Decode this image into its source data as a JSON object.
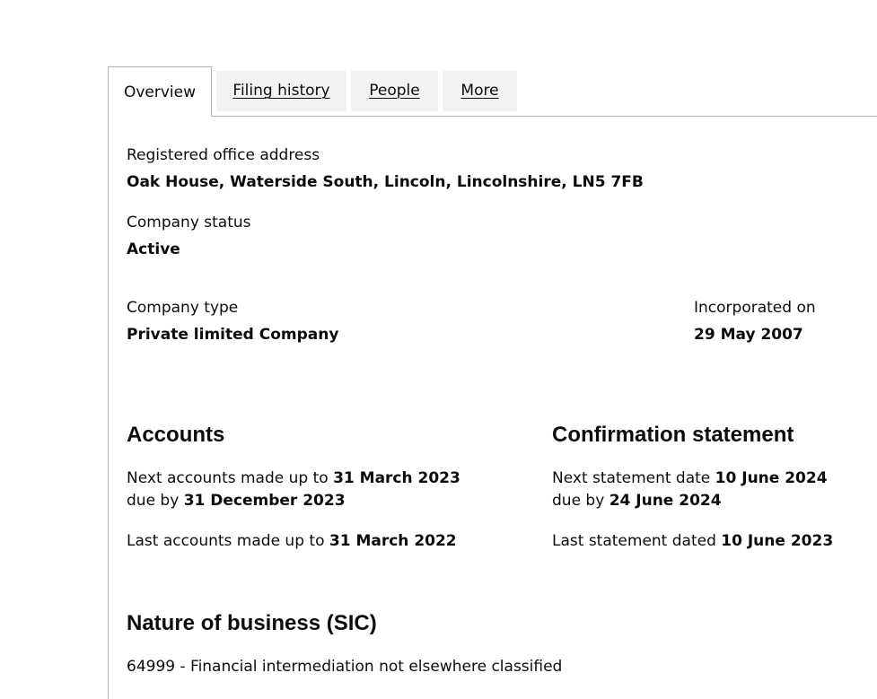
{
  "tabs": {
    "overview": "Overview",
    "filing_history": "Filing history",
    "people": "People",
    "more": "More"
  },
  "registered_office": {
    "label": "Registered office address",
    "value": "Oak House, Waterside South, Lincoln, Lincolnshire, LN5 7FB"
  },
  "company_status": {
    "label": "Company status",
    "value": "Active"
  },
  "company_type": {
    "label": "Company type",
    "value": "Private limited Company"
  },
  "incorporated": {
    "label": "Incorporated on",
    "value": "29 May 2007"
  },
  "accounts": {
    "heading": "Accounts",
    "next_prefix": "Next accounts made up to ",
    "next_date": "31 March 2023",
    "due_prefix": "due by ",
    "due_date": "31 December 2023",
    "last_prefix": "Last accounts made up to ",
    "last_date": "31 March 2022"
  },
  "confirmation": {
    "heading": "Confirmation statement",
    "next_prefix": "Next statement date ",
    "next_date": "10 June 2024",
    "due_prefix": "due by ",
    "due_date": "24 June 2024",
    "last_prefix": "Last statement dated ",
    "last_date": "10 June 2023"
  },
  "sic": {
    "heading": "Nature of business (SIC)",
    "item": "64999 - Financial intermediation not elsewhere classified"
  }
}
